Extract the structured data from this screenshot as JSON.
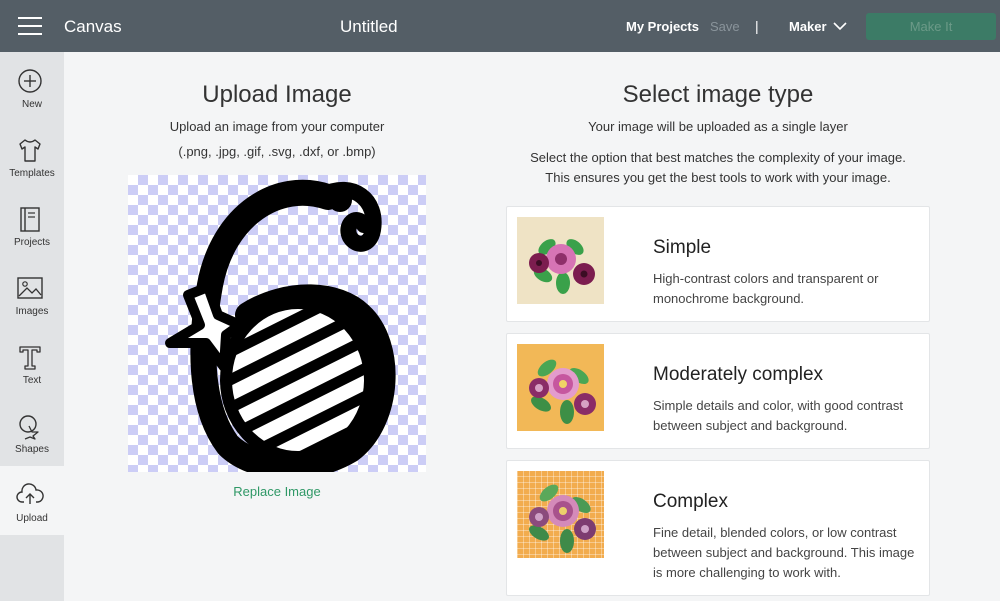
{
  "header": {
    "app_title": "Canvas",
    "doc_title": "Untitled",
    "my_projects": "My Projects",
    "save": "Save",
    "separator": "|",
    "machine": "Maker",
    "make_it": "Make It"
  },
  "sidebar": {
    "items": [
      {
        "label": "New",
        "icon": "plus-circle-icon"
      },
      {
        "label": "Templates",
        "icon": "shirt-icon"
      },
      {
        "label": "Projects",
        "icon": "notebook-icon"
      },
      {
        "label": "Images",
        "icon": "image-icon"
      },
      {
        "label": "Text",
        "icon": "text-t-icon"
      },
      {
        "label": "Shapes",
        "icon": "shapes-icon"
      },
      {
        "label": "Upload",
        "icon": "cloud-upload-icon"
      }
    ]
  },
  "upload": {
    "title": "Upload Image",
    "subtitle": "Upload an image from your computer",
    "formats": "(.png, .jpg, .gif, .svg, .dxf, or .bmp)",
    "replace": "Replace Image"
  },
  "image_type": {
    "title": "Select image type",
    "subtitle": "Your image will be uploaded as a single layer",
    "desc_line1": "Select the option that best matches the complexity of your image.",
    "desc_line2": "This ensures you get the best tools to work with your image.",
    "options": [
      {
        "title": "Simple",
        "desc": "High-contrast colors and transparent or monochrome background."
      },
      {
        "title": "Moderately complex",
        "desc": "Simple details and color, with good contrast between subject and background."
      },
      {
        "title": "Complex",
        "desc": "Fine detail, blended colors, or low contrast between subject and background. This image is more challenging to work with."
      }
    ]
  },
  "colors": {
    "topbar": "#545e66",
    "accent_green": "#2f9866",
    "make_it_button": "#3c7b66",
    "checker": "#cccdf6"
  }
}
